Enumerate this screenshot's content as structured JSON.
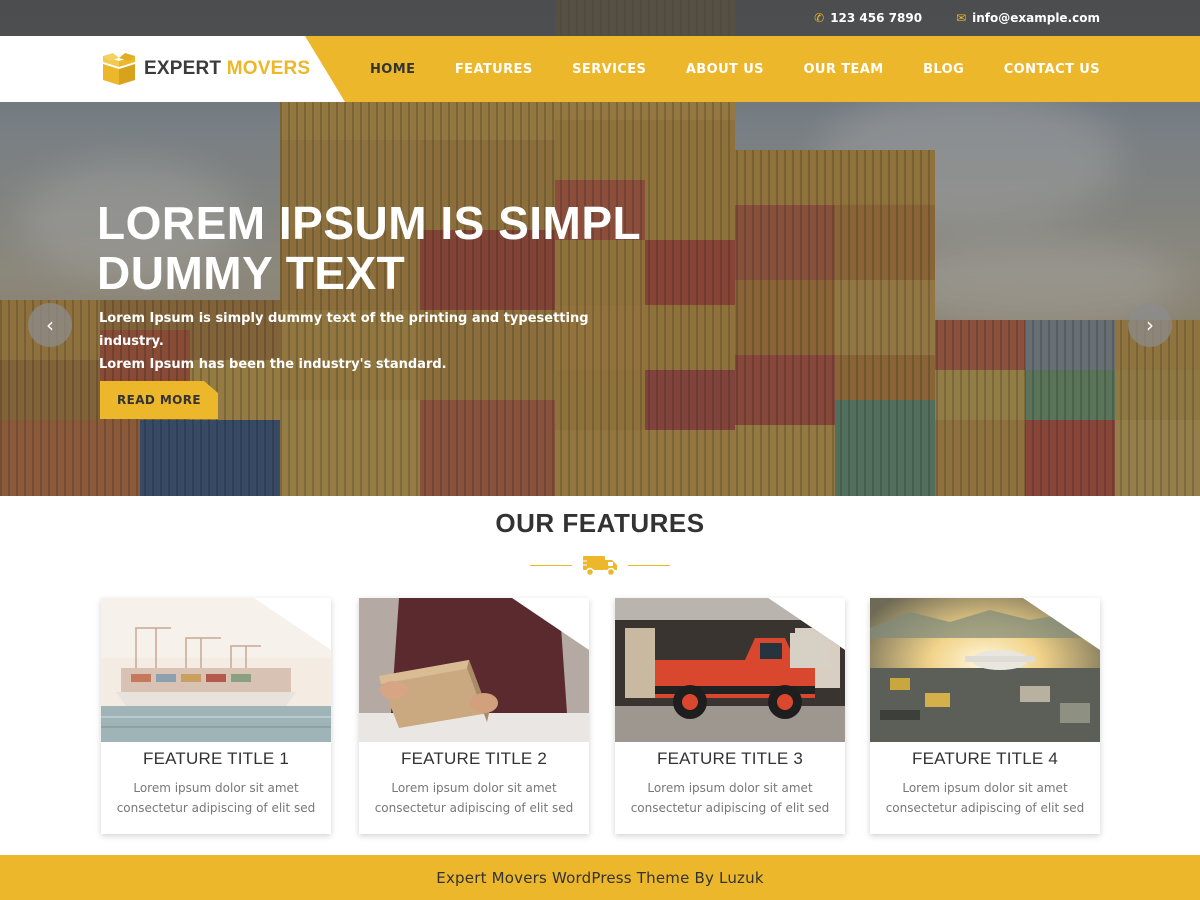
{
  "topbar": {
    "phone": "123 456 7890",
    "email": "info@example.com",
    "phone_icon": "phone-icon",
    "email_icon": "envelope-icon"
  },
  "brand": {
    "name_part1": "EXPERT",
    "name_part2": "MOVERS",
    "icon": "box-icon"
  },
  "nav": {
    "items": [
      {
        "label": "HOME",
        "active": true
      },
      {
        "label": "FEATURES"
      },
      {
        "label": "SERVICES"
      },
      {
        "label": "ABOUT US"
      },
      {
        "label": "OUR TEAM"
      },
      {
        "label": "BLOG"
      },
      {
        "label": "CONTACT US"
      }
    ]
  },
  "hero": {
    "title_line1": "LOREM IPSUM IS SIMPL",
    "title_line2": "DUMMY TEXT",
    "subtitle_line1": "Lorem Ipsum is simply dummy text of the printing and typesetting industry.",
    "subtitle_line2": "Lorem Ipsum has been the industry's standard.",
    "button_label": "READ MORE",
    "prev_icon": "‹",
    "next_icon": "›"
  },
  "features": {
    "heading": "OUR FEATURES",
    "divider_icon": "truck-icon",
    "cards": [
      {
        "title": "FEATURE TITLE 1",
        "text_line1": "Lorem ipsum dolor sit amet",
        "text_line2": "consectetur adipiscing of elit sed"
      },
      {
        "title": "FEATURE TITLE 2",
        "text_line1": "Lorem ipsum dolor sit amet",
        "text_line2": "consectetur adipiscing of elit sed"
      },
      {
        "title": "FEATURE TITLE 3",
        "text_line1": "Lorem ipsum dolor sit amet",
        "text_line2": "consectetur adipiscing of elit sed"
      },
      {
        "title": "FEATURE TITLE 4",
        "text_line1": "Lorem ipsum dolor sit amet",
        "text_line2": "consectetur adipiscing of elit sed"
      }
    ]
  },
  "footer": {
    "text": "Expert Movers WordPress Theme By Luzuk"
  },
  "colors": {
    "accent": "#ecb72a",
    "dark_text": "#333333",
    "body_text": "#777777"
  }
}
